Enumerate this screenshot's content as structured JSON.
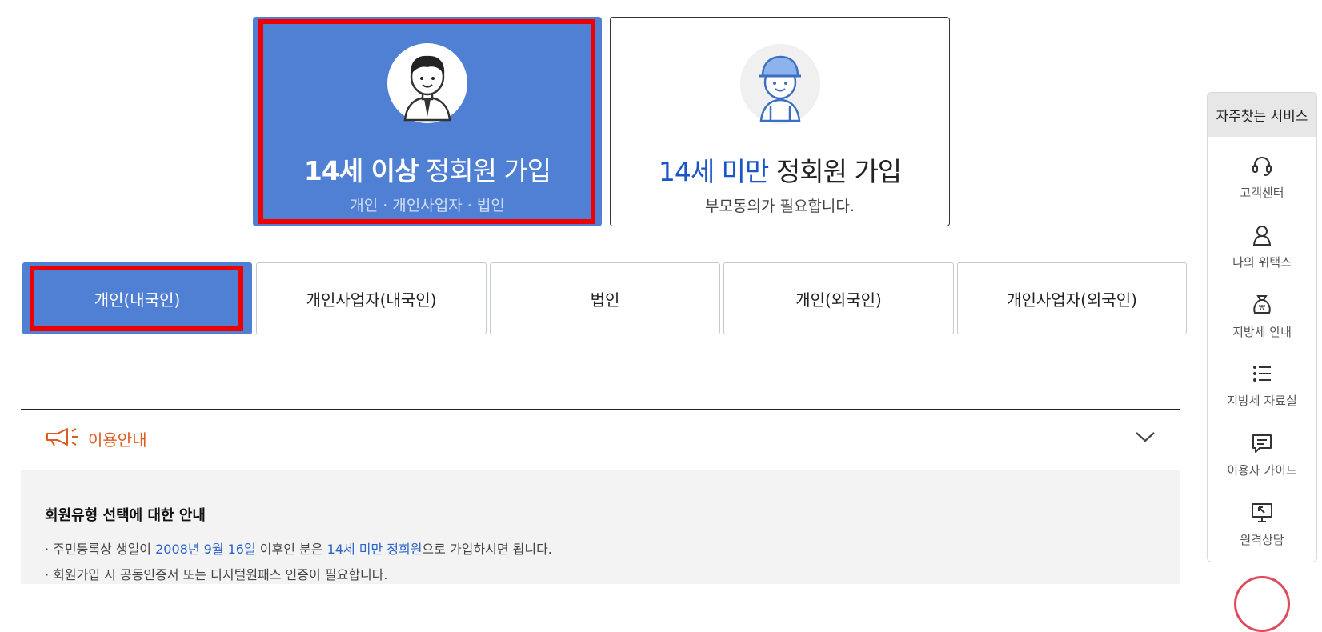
{
  "member_cards": {
    "adult": {
      "title_em": "14세 이상",
      "title_rest": " 정회원 가입",
      "subtitle": "개인 · 개인사업자 · 법인"
    },
    "minor": {
      "title_em": "14세 미만",
      "title_rest": " 정회원 가입",
      "subtitle": "부모동의가 필요합니다."
    }
  },
  "tabs": [
    {
      "label": "개인(내국인)",
      "active": true
    },
    {
      "label": "개인사업자(내국인)",
      "active": false
    },
    {
      "label": "법인",
      "active": false
    },
    {
      "label": "개인(외국인)",
      "active": false
    },
    {
      "label": "개인사업자(외국인)",
      "active": false
    }
  ],
  "info": {
    "section_title": "이용안내",
    "heading": "회원유형 선택에 대한 안내",
    "line1": {
      "a": "· 주민등록상 생일이 ",
      "b": "2008년 9월 16일",
      "c": " 이후인 분은 ",
      "d": "14세 미만 정회원",
      "e": "으로 가입하시면 됩니다."
    },
    "line2": "· 회원가입 시 공동인증서 또는 디지털원패스 인증이 필요합니다."
  },
  "quick_services": {
    "title": "자주찾는 서비스",
    "items": [
      {
        "label": "고객센터",
        "icon": "headset-icon"
      },
      {
        "label": "나의 위택스",
        "icon": "person-icon"
      },
      {
        "label": "지방세 안내",
        "icon": "money-bag-icon"
      },
      {
        "label": "지방세 자료실",
        "icon": "list-icon"
      },
      {
        "label": "이용자 가이드",
        "icon": "chat-icon"
      },
      {
        "label": "원격상담",
        "icon": "monitor-icon"
      }
    ]
  },
  "colors": {
    "primary": "#4f80d3",
    "highlight_blue": "#2a64c8",
    "accent_orange": "#e05a1f",
    "selection_red": "#ee0000"
  }
}
